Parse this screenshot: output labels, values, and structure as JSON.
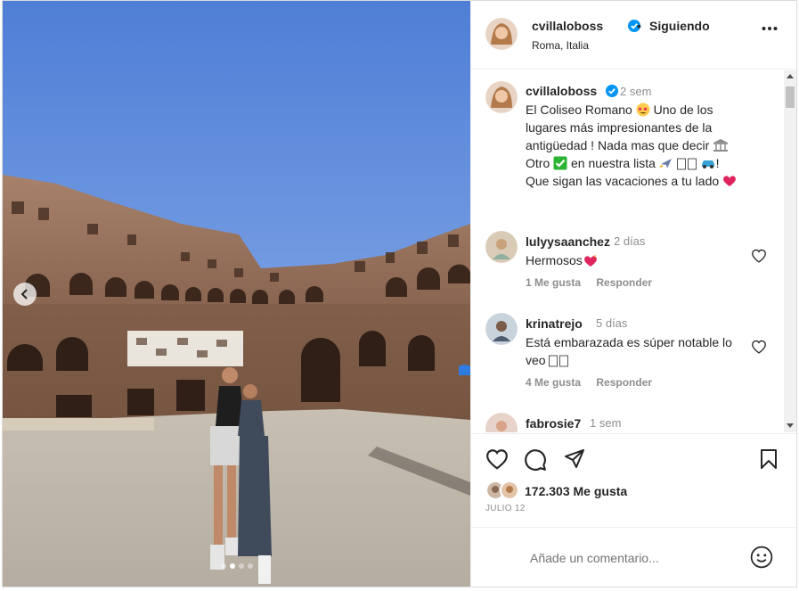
{
  "header": {
    "username": "cvillaloboss",
    "separator": "•",
    "follow_label": "Siguiendo",
    "location": "Roma, Italia"
  },
  "caption": {
    "username": "cvillaloboss",
    "time": "2 sem",
    "lines": [
      "El Coliseo Romano",
      "Uno de los",
      "lugares más impresionantes de la",
      "antigüedad ! Nada mas que decir",
      "Otro",
      "en nuestra lista",
      "!",
      "Que sigan las vacaciones a tu lado"
    ]
  },
  "comments": [
    {
      "username": "lulyysaanchez",
      "time": "2 días",
      "text": "Hermosos",
      "likes": "1 Me gusta",
      "reply": "Responder"
    },
    {
      "username": "krinatrejo",
      "time": "5 días",
      "text": "Está embarazada es súper notable lo veo",
      "likes": "4 Me gusta",
      "reply": "Responder"
    },
    {
      "username": "fabrosie7",
      "time": "1 sem"
    }
  ],
  "likes": {
    "count": "172.303 Me gusta"
  },
  "date": "JULIO 12",
  "comment_input": {
    "placeholder": "Añade un comentario..."
  },
  "colors": {
    "verified": "#0095f6",
    "text": "#262626",
    "secondary": "#8e8e8e",
    "heart_emoji": "#e0245e",
    "sky": "#6f9ae3"
  },
  "icons": [
    "chevron-left-icon",
    "more-icon",
    "verified-icon",
    "heart-icon",
    "comment-icon",
    "share-icon",
    "bookmark-icon",
    "emoji-icon"
  ],
  "carousel": {
    "total": 4,
    "active": 2
  }
}
